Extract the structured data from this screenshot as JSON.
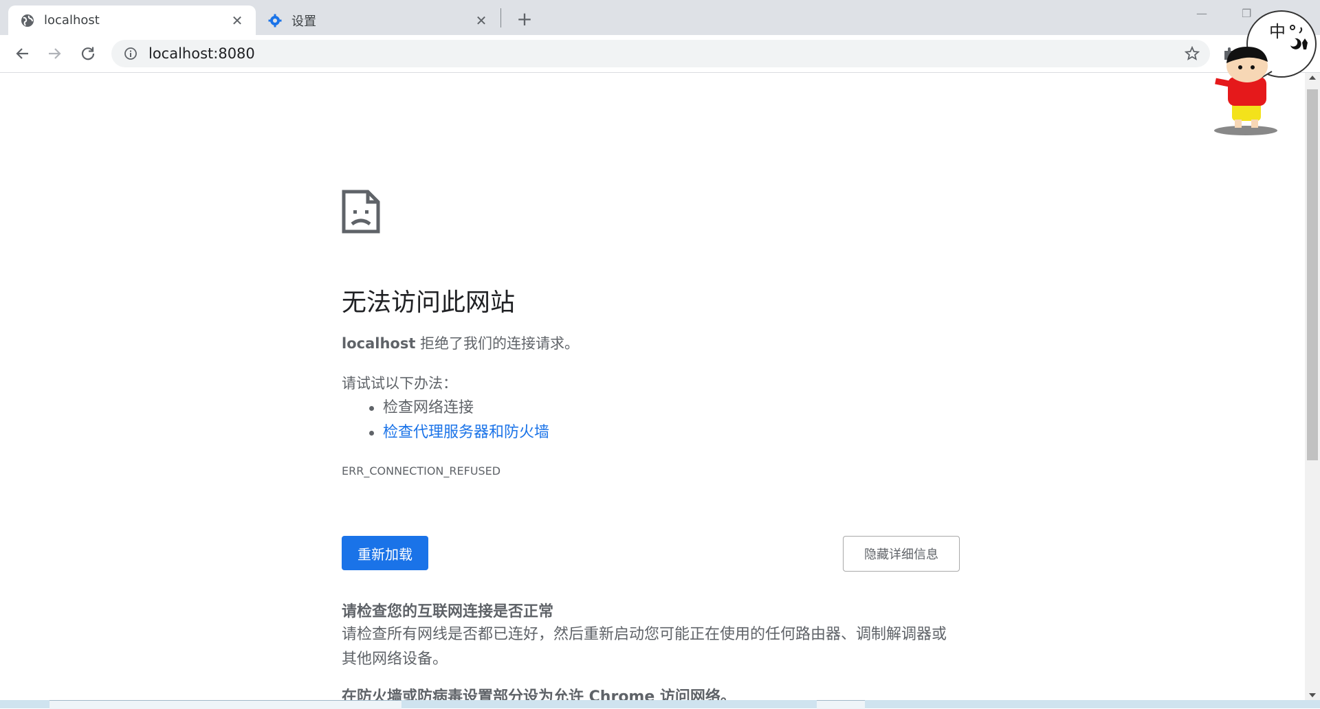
{
  "tabs": [
    {
      "title": "localhost",
      "active": true,
      "icon": "globe-icon"
    },
    {
      "title": "设置",
      "active": false,
      "icon": "gear-icon"
    }
  ],
  "address_bar": {
    "url": "localhost:8080"
  },
  "error_page": {
    "heading": "无法访问此网站",
    "host": "localhost",
    "refused_text": " 拒绝了我们的连接请求。",
    "try_label": "请试试以下办法：",
    "suggestions": [
      "检查网络连接",
      "检查代理服务器和防火墙"
    ],
    "error_code": "ERR_CONNECTION_REFUSED",
    "reload_button": "重新加载",
    "details_button": "隐藏详细信息",
    "section1_title": "请检查您的互联网连接是否正常",
    "section1_body": "请检查所有网线是否都已连好，然后重新启动您可能正在使用的任何路由器、调制解调器或其他网络设备。",
    "section2_title": "在防火墙或防病毒设置部分设为允许 Chrome 访问网络。"
  },
  "overlay": {
    "ime_char": "中"
  },
  "colors": {
    "accent": "#1a73e8",
    "tabstrip": "#dee1e6",
    "text": "#202124",
    "muted": "#5f6368"
  }
}
